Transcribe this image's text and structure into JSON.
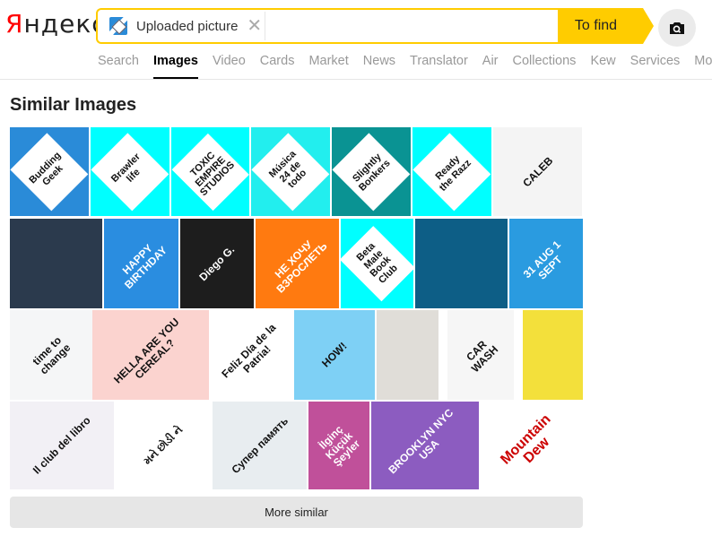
{
  "header": {
    "logo_first": "Я",
    "logo_rest": "ндекс",
    "search": {
      "chip_label": "Uploaded picture",
      "input_value": "",
      "input_placeholder": "",
      "find_label": "To find"
    }
  },
  "tabs": [
    {
      "label": "Search",
      "active": false
    },
    {
      "label": "Images",
      "active": true
    },
    {
      "label": "Video",
      "active": false
    },
    {
      "label": "Cards",
      "active": false
    },
    {
      "label": "Market",
      "active": false
    },
    {
      "label": "News",
      "active": false
    },
    {
      "label": "Translator",
      "active": false
    },
    {
      "label": "Air",
      "active": false
    },
    {
      "label": "Collections",
      "active": false
    },
    {
      "label": "Kew",
      "active": false
    },
    {
      "label": "Services",
      "active": false
    },
    {
      "label": "More",
      "active": false
    }
  ],
  "similar": {
    "title": "Similar Images",
    "more_label": "More similar",
    "images": [
      {
        "caption": "Budding\nGeek",
        "bg": "#2a8bd8",
        "card": true
      },
      {
        "caption": "Brawler\nlife",
        "bg": "#00ffff",
        "card": true
      },
      {
        "caption": "TOXIC\nEMPIRE\nSTUDIOS",
        "bg": "#00ffff",
        "card": true
      },
      {
        "caption": "Música\n24 de\ntodo",
        "bg": "#22eeee",
        "card": true
      },
      {
        "caption": "Slightly\nBonkers",
        "bg": "#0a9393",
        "card": true
      },
      {
        "caption": "Ready\nthe Razz",
        "bg": "#00ffff",
        "card": true
      },
      {
        "caption": "CALEB",
        "bg": "#f4f4f4",
        "card": false
      },
      {
        "caption": "",
        "bg": "#2b3a4d",
        "card": false
      },
      {
        "caption": "HAPPY BIRTHDAY",
        "bg": "#2a8de0",
        "card": false
      },
      {
        "caption": "Diego G.",
        "bg": "#1d1d1d",
        "card": false
      },
      {
        "caption": "НЕ ХОЧУ ВЗРОСЛЕТЬ",
        "bg": "#ff7a10",
        "card": false
      },
      {
        "caption": "Beta\nMale\nBook\nClub",
        "bg": "#00ffff",
        "card": true
      },
      {
        "caption": "",
        "bg": "#0d5e86",
        "card": false
      },
      {
        "caption": "31 AUG 1 SEPT",
        "bg": "#2a9be0",
        "card": false
      },
      {
        "caption": "time to change",
        "bg": "#f5f6f7",
        "card": false
      },
      {
        "caption": "HELLA ARE YOU CEREAL?",
        "bg": "#fbd3cf",
        "card": false
      },
      {
        "caption": "Feliz Día de la Patria!",
        "bg": "#ffffff",
        "card": false
      },
      {
        "caption": "HOW!",
        "bg": "#7ed0f5",
        "card": false
      },
      {
        "caption": "",
        "bg": "#e0ddd8",
        "card": false
      },
      {
        "caption": "CAR WASH",
        "bg": "#f6f6f6",
        "card": false
      },
      {
        "caption": "",
        "bg": "#f3e03b",
        "card": false
      },
      {
        "caption": "Il club del libro",
        "bg": "#f2f0f5",
        "card": false
      },
      {
        "caption": "મને છોડી ને",
        "bg": "#ffffff",
        "card": false
      },
      {
        "caption": "Супер память",
        "bg": "#e8edf0",
        "card": false
      },
      {
        "caption": "İlginç Küçük Şeyler",
        "bg": "#c0509a",
        "card": false
      },
      {
        "caption": "BROOKLYN NYC USA",
        "bg": "#8c5cc0",
        "card": false
      },
      {
        "caption": "Mountain Dew",
        "bg": "#ffffff",
        "card": false
      }
    ]
  }
}
